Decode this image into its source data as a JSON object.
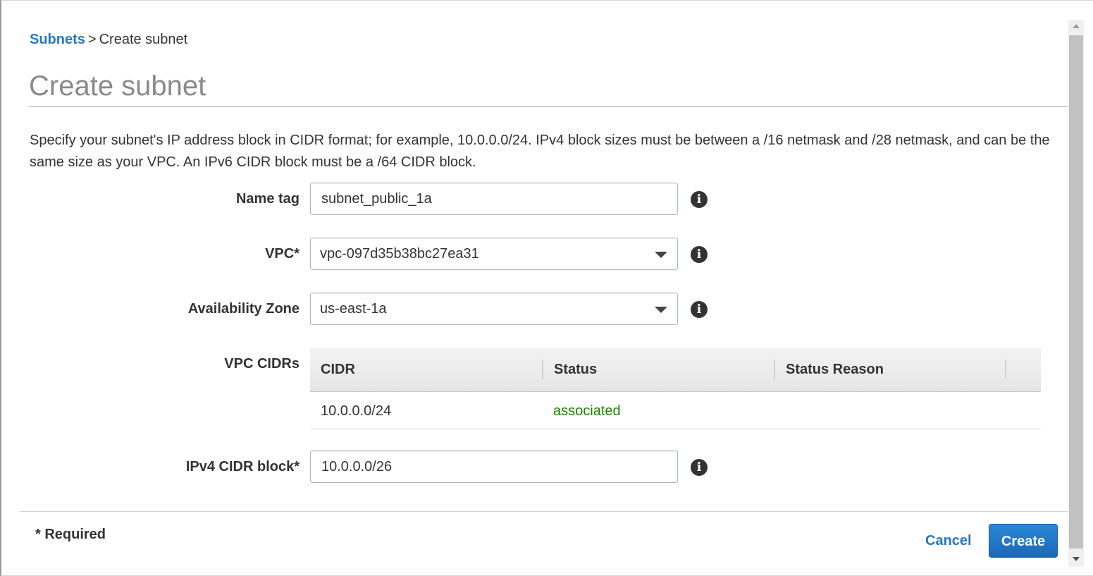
{
  "breadcrumb": {
    "link": "Subnets",
    "separator": ">",
    "current": "Create subnet"
  },
  "page": {
    "title": "Create subnet",
    "description": "Specify your subnet's IP address block in CIDR format; for example, 10.0.0.0/24. IPv4 block sizes must be between a /16 netmask and /28 netmask, and can be the same size as your VPC. An IPv6 CIDR block must be a /64 CIDR block."
  },
  "form": {
    "name_tag": {
      "label": "Name tag",
      "value": "subnet_public_1a"
    },
    "vpc": {
      "label": "VPC*",
      "value": "vpc-097d35b38bc27ea31"
    },
    "availability_zone": {
      "label": "Availability Zone",
      "value": "us-east-1a"
    },
    "vpc_cidrs": {
      "label": "VPC CIDRs",
      "columns": [
        "CIDR",
        "Status",
        "Status Reason"
      ],
      "rows": [
        {
          "cidr": "10.0.0.0/24",
          "status": "associated",
          "status_reason": ""
        }
      ]
    },
    "ipv4_cidr_block": {
      "label": "IPv4 CIDR block*",
      "value": "10.0.0.0/26"
    },
    "info_icon_glyph": "i"
  },
  "footer": {
    "required_note": "* Required",
    "cancel_label": "Cancel",
    "create_label": "Create"
  },
  "colors": {
    "link": "#2479c2",
    "status_ok": "#1d8102",
    "primary_button": "#1c68b8"
  }
}
